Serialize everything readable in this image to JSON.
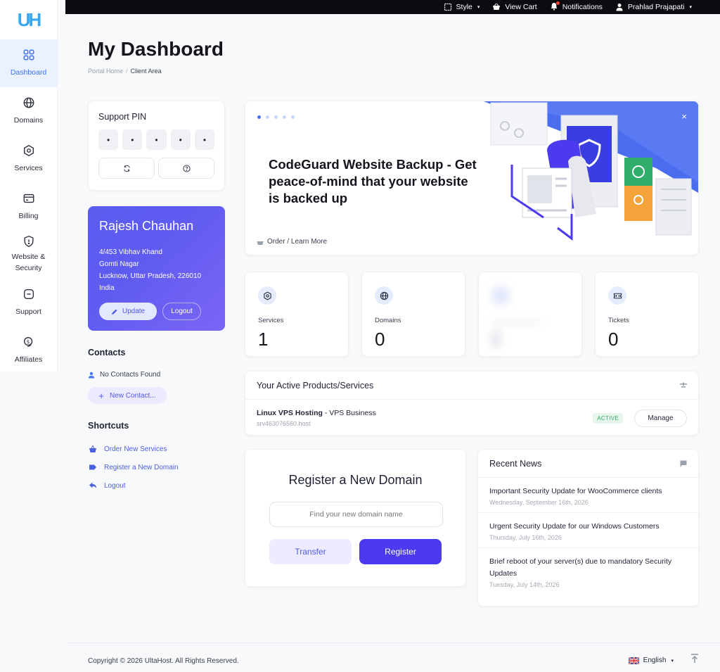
{
  "brand": {
    "logo_text": "UH"
  },
  "sidebar": {
    "items": [
      {
        "label": "Dashboard",
        "icon": "grid-icon"
      },
      {
        "label": "Domains",
        "icon": "globe-icon"
      },
      {
        "label": "Services",
        "icon": "hexagon-icon"
      },
      {
        "label": "Billing",
        "icon": "card-icon"
      },
      {
        "label": "Website &",
        "label2": "Security",
        "icon": "shield-icon"
      },
      {
        "label": "Support",
        "icon": "support-icon"
      },
      {
        "label": "Affiliates",
        "icon": "coin-icon"
      }
    ]
  },
  "topbar": {
    "style": "Style",
    "cart": "View Cart",
    "notifications": "Notifications",
    "user": "Prahlad Prajapati"
  },
  "page": {
    "title": "My Dashboard",
    "breadcrumb": {
      "home": "Portal Home",
      "current": "Client Area"
    }
  },
  "support_pin": {
    "title": "Support PIN",
    "digits": [
      "•",
      "•",
      "•",
      "•",
      "•"
    ]
  },
  "profile": {
    "name": "Rajesh Chauhan",
    "address": [
      "4/453 Vibhav Khand",
      "Gomti Nagar",
      "Lucknow, Uttar Pradesh, 226010",
      "India"
    ],
    "update_label": "Update",
    "logout_label": "Logout"
  },
  "contacts": {
    "title": "Contacts",
    "empty_text": "No Contacts Found",
    "new_label": "New Contact..."
  },
  "shortcuts": {
    "title": "Shortcuts",
    "items": [
      "Order New Services",
      "Register a New Domain",
      "Logout"
    ]
  },
  "banner": {
    "title": "CodeGuard Website Backup - Get peace-of-mind that your website is backed up",
    "link": "Order / Learn More",
    "close": "×"
  },
  "stats": [
    {
      "label": "Services",
      "value": "1",
      "icon": "hexagon-icon"
    },
    {
      "label": "Domains",
      "value": "0",
      "icon": "globe-icon"
    },
    {
      "label": "",
      "value": "",
      "icon": "blurred-icon"
    },
    {
      "label": "Tickets",
      "value": "0",
      "icon": "ticket-icon"
    }
  ],
  "products": {
    "title": "Your Active Products/Services",
    "items": [
      {
        "name": "Linux VPS Hosting",
        "plan": " - VPS Business",
        "host": "srv463076560.host",
        "status": "ACTIVE",
        "action": "Manage"
      }
    ]
  },
  "register": {
    "title": "Register a New Domain",
    "placeholder": "Find your new domain name",
    "transfer_label": "Transfer",
    "register_label": "Register"
  },
  "news": {
    "title": "Recent News",
    "items": [
      {
        "title": "Important Security Update for WooCommerce clients",
        "date": "Wednesday, September 16th, 2026"
      },
      {
        "title": "Urgent Security Update for our Windows Customers",
        "date": "Thursday, July 16th, 2026"
      },
      {
        "title": "Brief reboot of your server(s) due to mandatory Security Updates",
        "date": "Tuesday, July 14th, 2026"
      }
    ]
  },
  "footer": {
    "copyright": "Copyright © 2026 UltaHost. All Rights Reserved.",
    "language": "English"
  },
  "colors": {
    "accent": "#4b3af0",
    "link": "#4a60e0",
    "sidebar_active": "#3b73f0",
    "active_badge": "#3aa96a"
  }
}
